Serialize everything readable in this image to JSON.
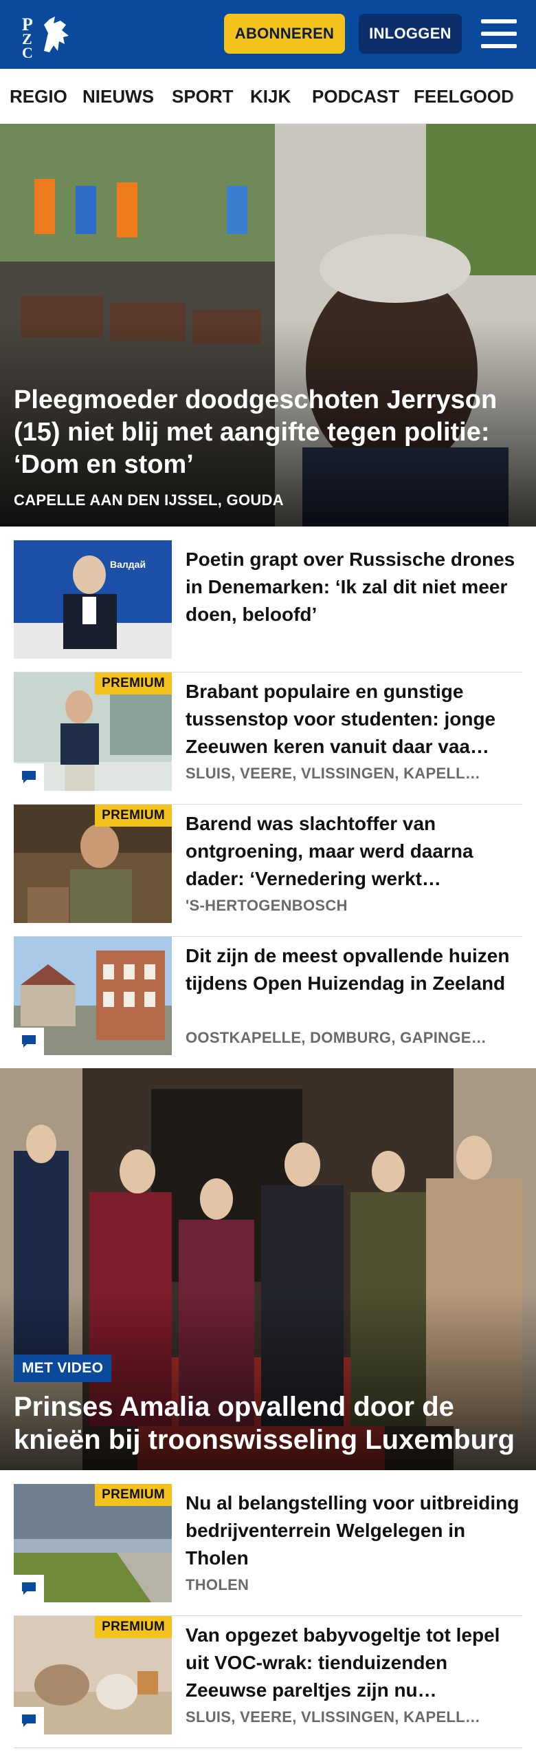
{
  "header": {
    "logo_text": "PZC",
    "subscribe_label": "ABONNEREN",
    "login_label": "INLOGGEN",
    "brand_color": "#0a4a9c",
    "accent_color": "#f4c21d"
  },
  "nav": {
    "items": [
      "REGIO",
      "NIEUWS",
      "SPORT",
      "KIJK",
      "PODCAST",
      "FEELGOOD"
    ]
  },
  "hero": {
    "title": "Pleegmoeder doodgeschoten Jerryson (15) niet blij met aangifte tegen politie: ‘Dom en stom’",
    "location": "CAPELLE AAN DEN IJSSEL, GOUDA"
  },
  "articles": [
    {
      "title": "Poetin grapt over Russische drones in Denemarken: ‘Ik zal dit niet meer doen, beloofd’",
      "premium": "",
      "location": "",
      "comments": false
    },
    {
      "title": "Brabant populaire en gunstige tussenstop voor studenten: jonge Zeeuwen keren vanuit daar vaa…",
      "premium": "PREMIUM",
      "location": "SLUIS, VEERE, VLISSINGEN, KAPELL…",
      "comments": true
    },
    {
      "title": "Barend was slachtoffer van ontgroening, maar werd daarna dader: ‘Vernedering werkt…",
      "premium": "PREMIUM",
      "location": "'S-HERTOGENBOSCH",
      "comments": false
    },
    {
      "title": "Dit zijn de meest opvallende huizen tijdens Open Huizendag in Zeeland",
      "premium": "",
      "location": "OOSTKAPELLE, DOMBURG, GAPINGE…",
      "comments": true
    }
  ],
  "feature": {
    "badge": "MET VIDEO",
    "title": "Prinses Amalia opvallend door de knieën bij troonswisseling Luxemburg"
  },
  "articles2": [
    {
      "title": "Nu al belangstelling voor uitbrei­ding bedrijventerrein Welgelegen in Tholen",
      "premium": "PREMIUM",
      "location": "THOLEN",
      "comments": true
    },
    {
      "title": "Van opgezet babyvogeltje tot lepel uit VOC-wrak: tienduizen­den Zeeuwse pareltjes zijn nu…",
      "premium": "PREMIUM",
      "location": "SLUIS, VEERE, VLISSINGEN, KAPELL…",
      "comments": true
    }
  ]
}
